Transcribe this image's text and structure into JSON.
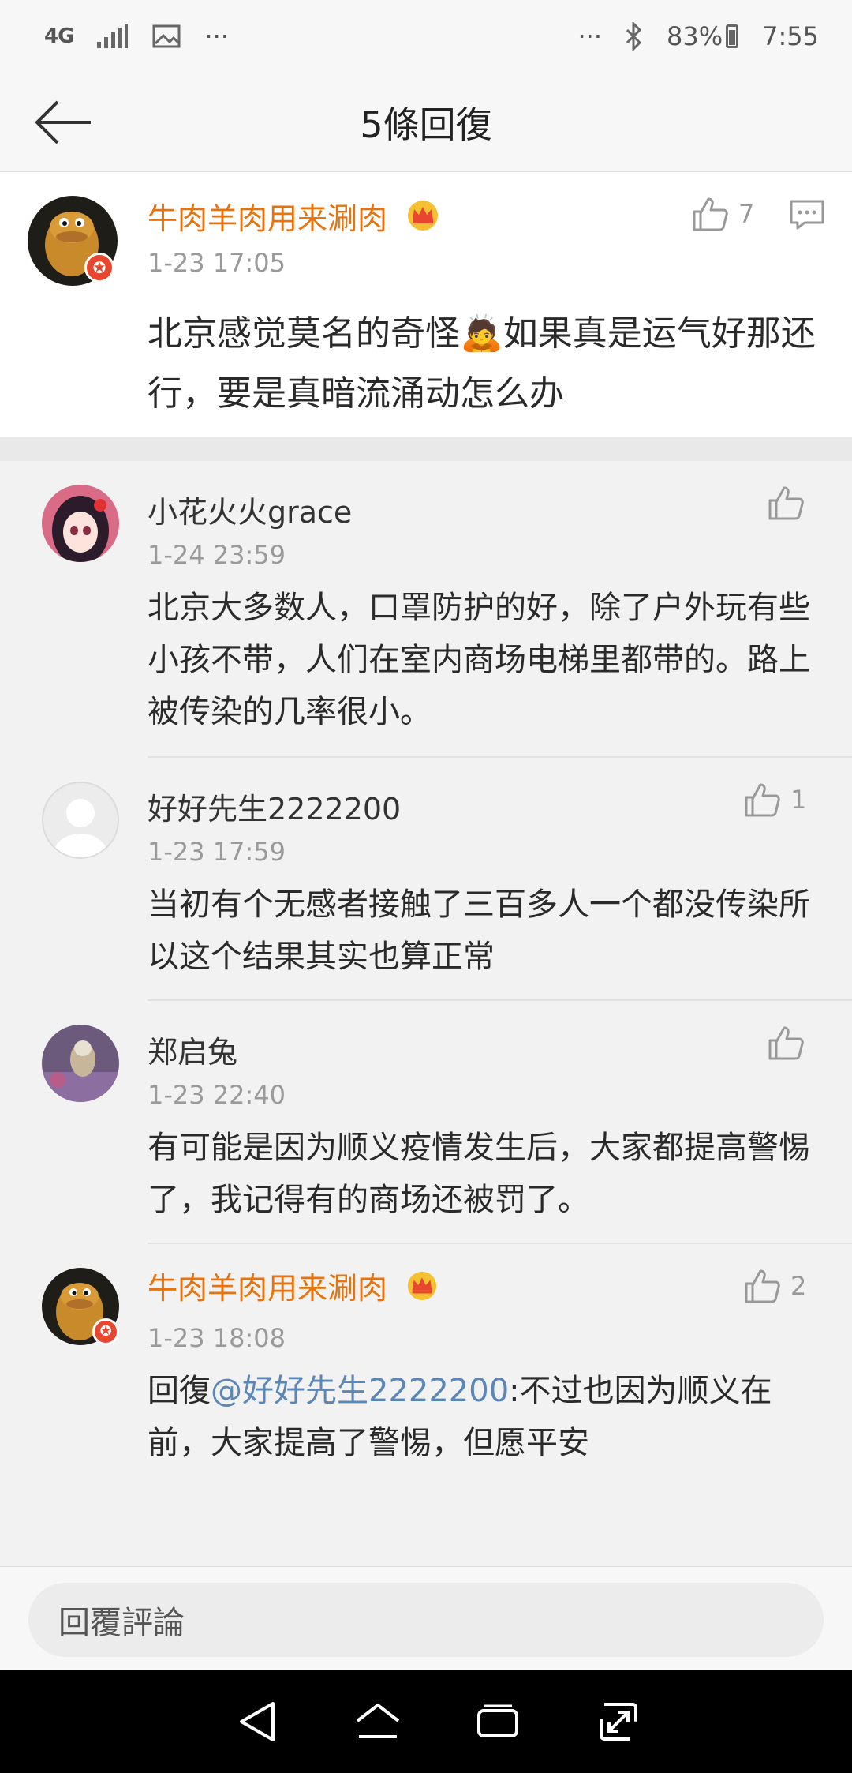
{
  "status_bar": {
    "network": "4G",
    "dots_left": "···",
    "dots_right": "···",
    "battery": "83%",
    "time": "7:55"
  },
  "header": {
    "title": "5條回復"
  },
  "root_comment": {
    "username": "牛肉羊肉用来涮肉",
    "time": "1-23 17:05",
    "text": "北京感觉莫名的奇怪🙇如果真是运气好那还行，要是真暗流涌动怎么办",
    "like_count": "7"
  },
  "replies": [
    {
      "username": "小花火火grace",
      "time": "1-24 23:59",
      "text": "北京大多数人，口罩防护的好，除了户外玩有些小孩不带，人们在室内商场电梯里都带的。路上被传染的几率很小。",
      "like_count": ""
    },
    {
      "username": "好好先生2222200",
      "time": "1-23 17:59",
      "text": "当初有个无感者接触了三百多人一个都没传染所以这个结果其实也算正常",
      "like_count": "1"
    },
    {
      "username": "郑启兔",
      "time": "1-23 22:40",
      "text": "有可能是因为顺义疫情发生后，大家都提高警惕了，我记得有的商场还被罚了。",
      "like_count": ""
    },
    {
      "username": "牛肉羊肉用来涮肉",
      "time": "1-23 18:08",
      "text_prefix": "回復",
      "mention": "@好好先生2222200",
      "text": ":不过也因为顺义在前，大家提高了警惕，但愿平安",
      "like_count": "2"
    }
  ],
  "input": {
    "placeholder": "回覆評論"
  },
  "colors": {
    "username_vip": "#e8730c",
    "mention": "#5b86b8",
    "badge": "#e8462f"
  },
  "icons": [
    "back-arrow-icon",
    "thumbs-up-icon",
    "comment-icon",
    "crown-icon",
    "bluetooth-icon",
    "signal-icon",
    "image-icon",
    "nav-back-icon",
    "nav-home-icon",
    "nav-recent-icon",
    "nav-expand-icon"
  ]
}
